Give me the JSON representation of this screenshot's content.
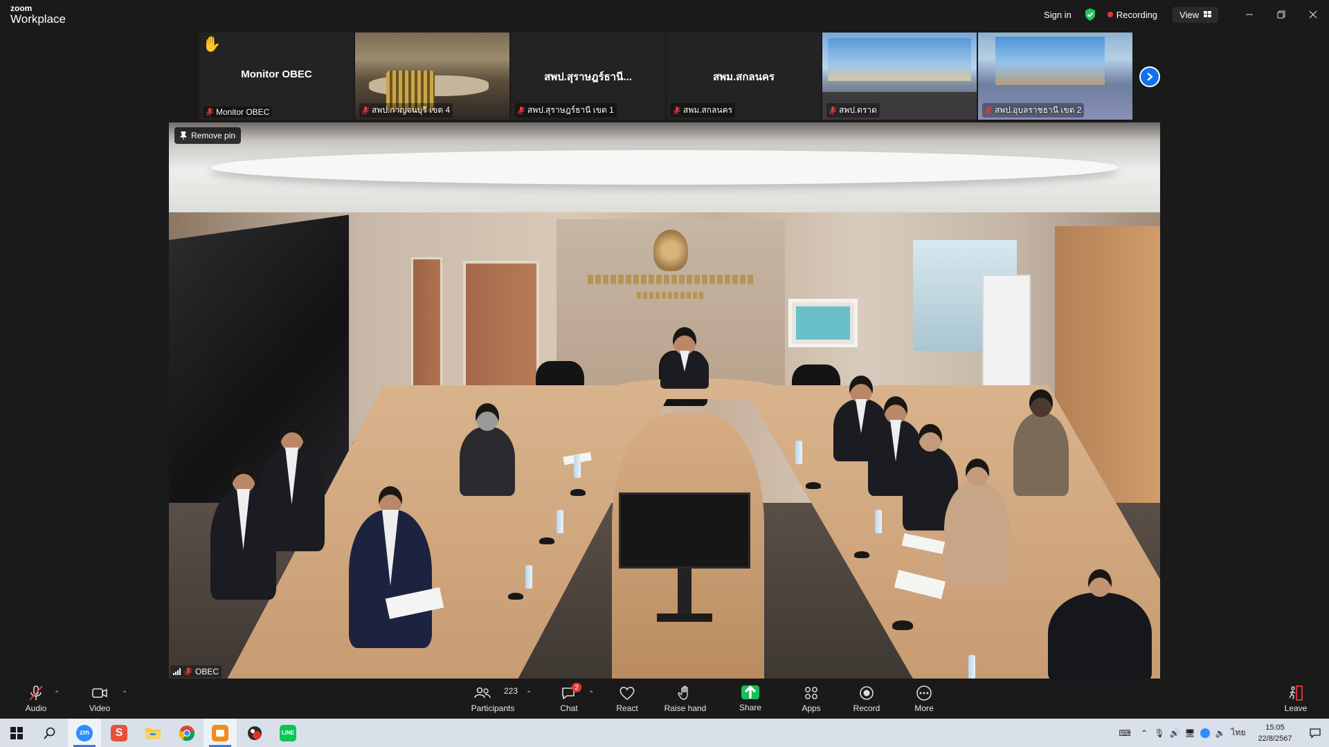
{
  "app": {
    "brand_top": "zoom",
    "brand_bottom": "Workplace"
  },
  "titlebar": {
    "sign_in": "Sign in",
    "recording": "Recording",
    "view": "View"
  },
  "strip": {
    "tiles": [
      {
        "center_name": "Monitor OBEC",
        "label": "Monitor OBEC",
        "raised_hand": true
      },
      {
        "center_name": "",
        "label": "สพป.กาญจนบุรี เขต 4"
      },
      {
        "center_name": "สพป.สุราษฎร์ธานี...",
        "label": "สพป.สุราษฎร์ธานี เขต 1"
      },
      {
        "center_name": "สพม.สกลนคร",
        "label": "สพม.สกลนคร"
      },
      {
        "center_name": "",
        "label": "สพป.ตราด"
      },
      {
        "center_name": "",
        "label": "สพป.อุบลราชธานี เขต 2"
      }
    ]
  },
  "main_video": {
    "remove_pin": "Remove pin",
    "speaker_label": "OBEC"
  },
  "toolbar": {
    "audio": "Audio",
    "video": "Video",
    "participants": "Participants",
    "participants_count": "223",
    "chat": "Chat",
    "chat_badge": "2",
    "react": "React",
    "raise_hand": "Raise hand",
    "share": "Share",
    "apps": "Apps",
    "record": "Record",
    "more": "More",
    "leave": "Leave"
  },
  "taskbar": {
    "apps": [
      "start-icon",
      "search-icon",
      "zoom-app-icon",
      "office-s-icon",
      "file-explorer-icon",
      "chrome-icon",
      "presentation-app-icon",
      "red-app-icon",
      "line-app-icon"
    ],
    "language": "ไทย",
    "time": "15:05",
    "date": "22/8/2567"
  },
  "colors": {
    "accent_blue": "#0e72ed",
    "record_red": "#e5383b",
    "share_green": "#16c05a",
    "toolbar_bg": "#1a1a1a"
  }
}
